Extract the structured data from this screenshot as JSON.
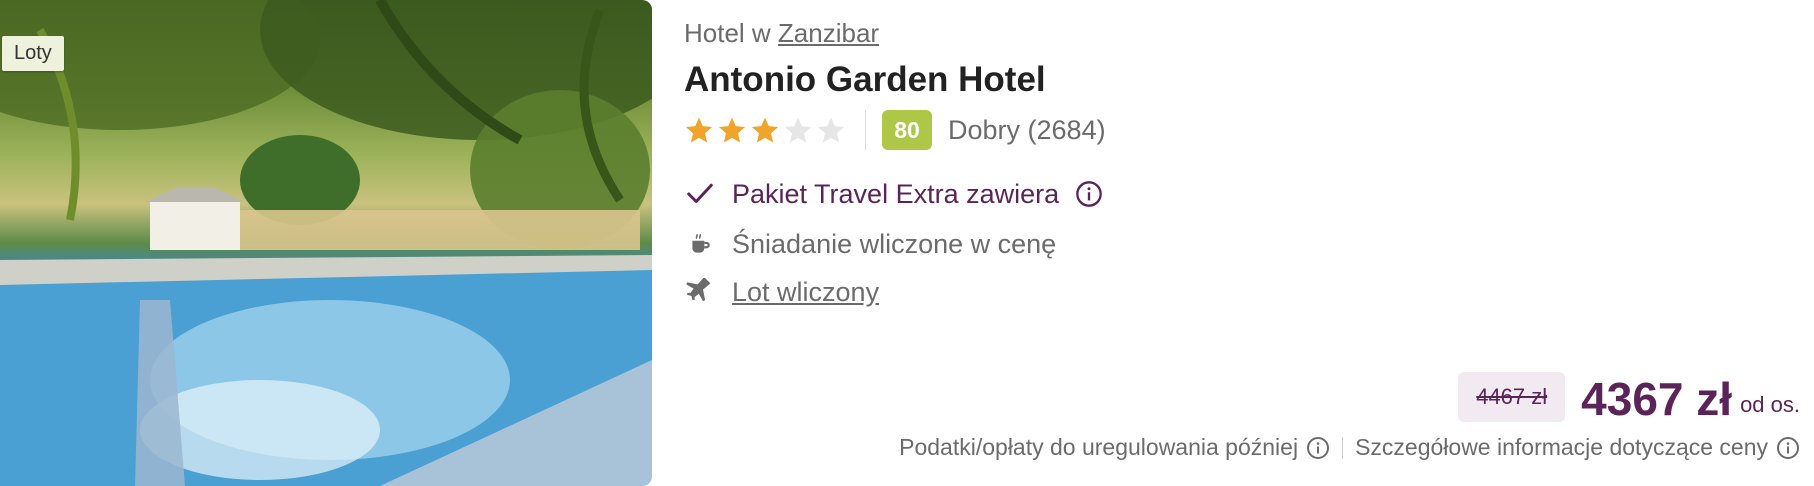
{
  "image": {
    "tag": "Loty"
  },
  "location": {
    "prefix": "Hotel w ",
    "place": "Zanzibar"
  },
  "hotel": {
    "name": "Antonio Garden Hotel"
  },
  "rating": {
    "stars": 3,
    "max_stars": 5,
    "score": "80",
    "score_label": "Dobry (2684)",
    "score_color": "#aec746",
    "star_color": "#f0a42b"
  },
  "features": {
    "package": "Pakiet Travel Extra zawiera",
    "breakfast": "Śniadanie wliczone w cenę",
    "flight": "Lot wliczony"
  },
  "price": {
    "old": "4467 zł",
    "current": "4367 zł",
    "per_person": "od os."
  },
  "footer": {
    "taxes": "Podatki/opłaty do uregulowania później",
    "details": "Szczegółowe informacje dotyczące ceny"
  },
  "colors": {
    "accent": "#5b2459",
    "muted": "#6b6b6b"
  },
  "icons": {
    "check": "check-icon",
    "info": "info-icon",
    "breakfast": "coffee-cup-icon",
    "flight": "airplane-icon",
    "star": "star-icon"
  }
}
